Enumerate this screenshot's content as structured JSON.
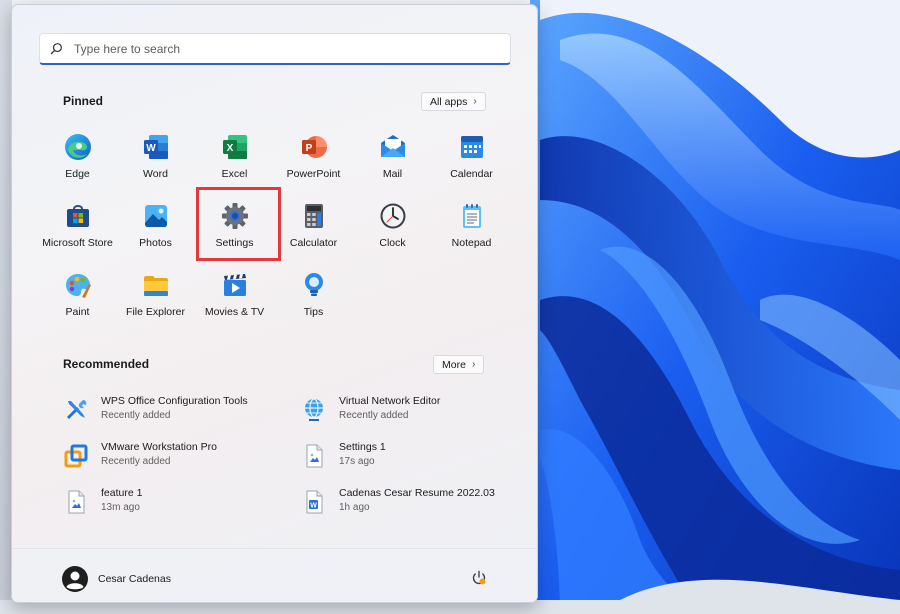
{
  "search": {
    "placeholder": "Type here to search"
  },
  "pinned": {
    "title": "Pinned",
    "all_apps_label": "All apps",
    "apps": [
      {
        "label": "Edge",
        "icon": "edge-icon"
      },
      {
        "label": "Word",
        "icon": "word-icon"
      },
      {
        "label": "Excel",
        "icon": "excel-icon"
      },
      {
        "label": "PowerPoint",
        "icon": "powerpoint-icon"
      },
      {
        "label": "Mail",
        "icon": "mail-icon"
      },
      {
        "label": "Calendar",
        "icon": "calendar-icon"
      },
      {
        "label": "Microsoft Store",
        "icon": "store-icon"
      },
      {
        "label": "Photos",
        "icon": "photos-icon"
      },
      {
        "label": "Settings",
        "icon": "gear-icon"
      },
      {
        "label": "Calculator",
        "icon": "calculator-icon"
      },
      {
        "label": "Clock",
        "icon": "clock-icon"
      },
      {
        "label": "Notepad",
        "icon": "notepad-icon"
      },
      {
        "label": "Paint",
        "icon": "paint-icon"
      },
      {
        "label": "File Explorer",
        "icon": "folder-icon"
      },
      {
        "label": "Movies & TV",
        "icon": "movies-icon"
      },
      {
        "label": "Tips",
        "icon": "lightbulb-icon"
      }
    ]
  },
  "recommended": {
    "title": "Recommended",
    "more_label": "More",
    "items": [
      {
        "name": "WPS Office Configuration Tools",
        "sub": "Recently added",
        "icon": "tools-icon"
      },
      {
        "name": "Virtual Network Editor",
        "sub": "Recently added",
        "icon": "globe-icon"
      },
      {
        "name": "VMware Workstation Pro",
        "sub": "Recently added",
        "icon": "vmware-icon"
      },
      {
        "name": "Settings 1",
        "sub": "17s ago",
        "icon": "image-file-icon"
      },
      {
        "name": "feature 1",
        "sub": "13m ago",
        "icon": "image-file-icon"
      },
      {
        "name": "Cadenas Cesar Resume 2022.03",
        "sub": "1h ago",
        "icon": "word-file-icon"
      }
    ]
  },
  "user": {
    "name": "Cesar Cadenas"
  },
  "colors": {
    "accent": "#2b63c8",
    "highlight": "#e0393e",
    "wallpaper": "#0a3fc8"
  }
}
